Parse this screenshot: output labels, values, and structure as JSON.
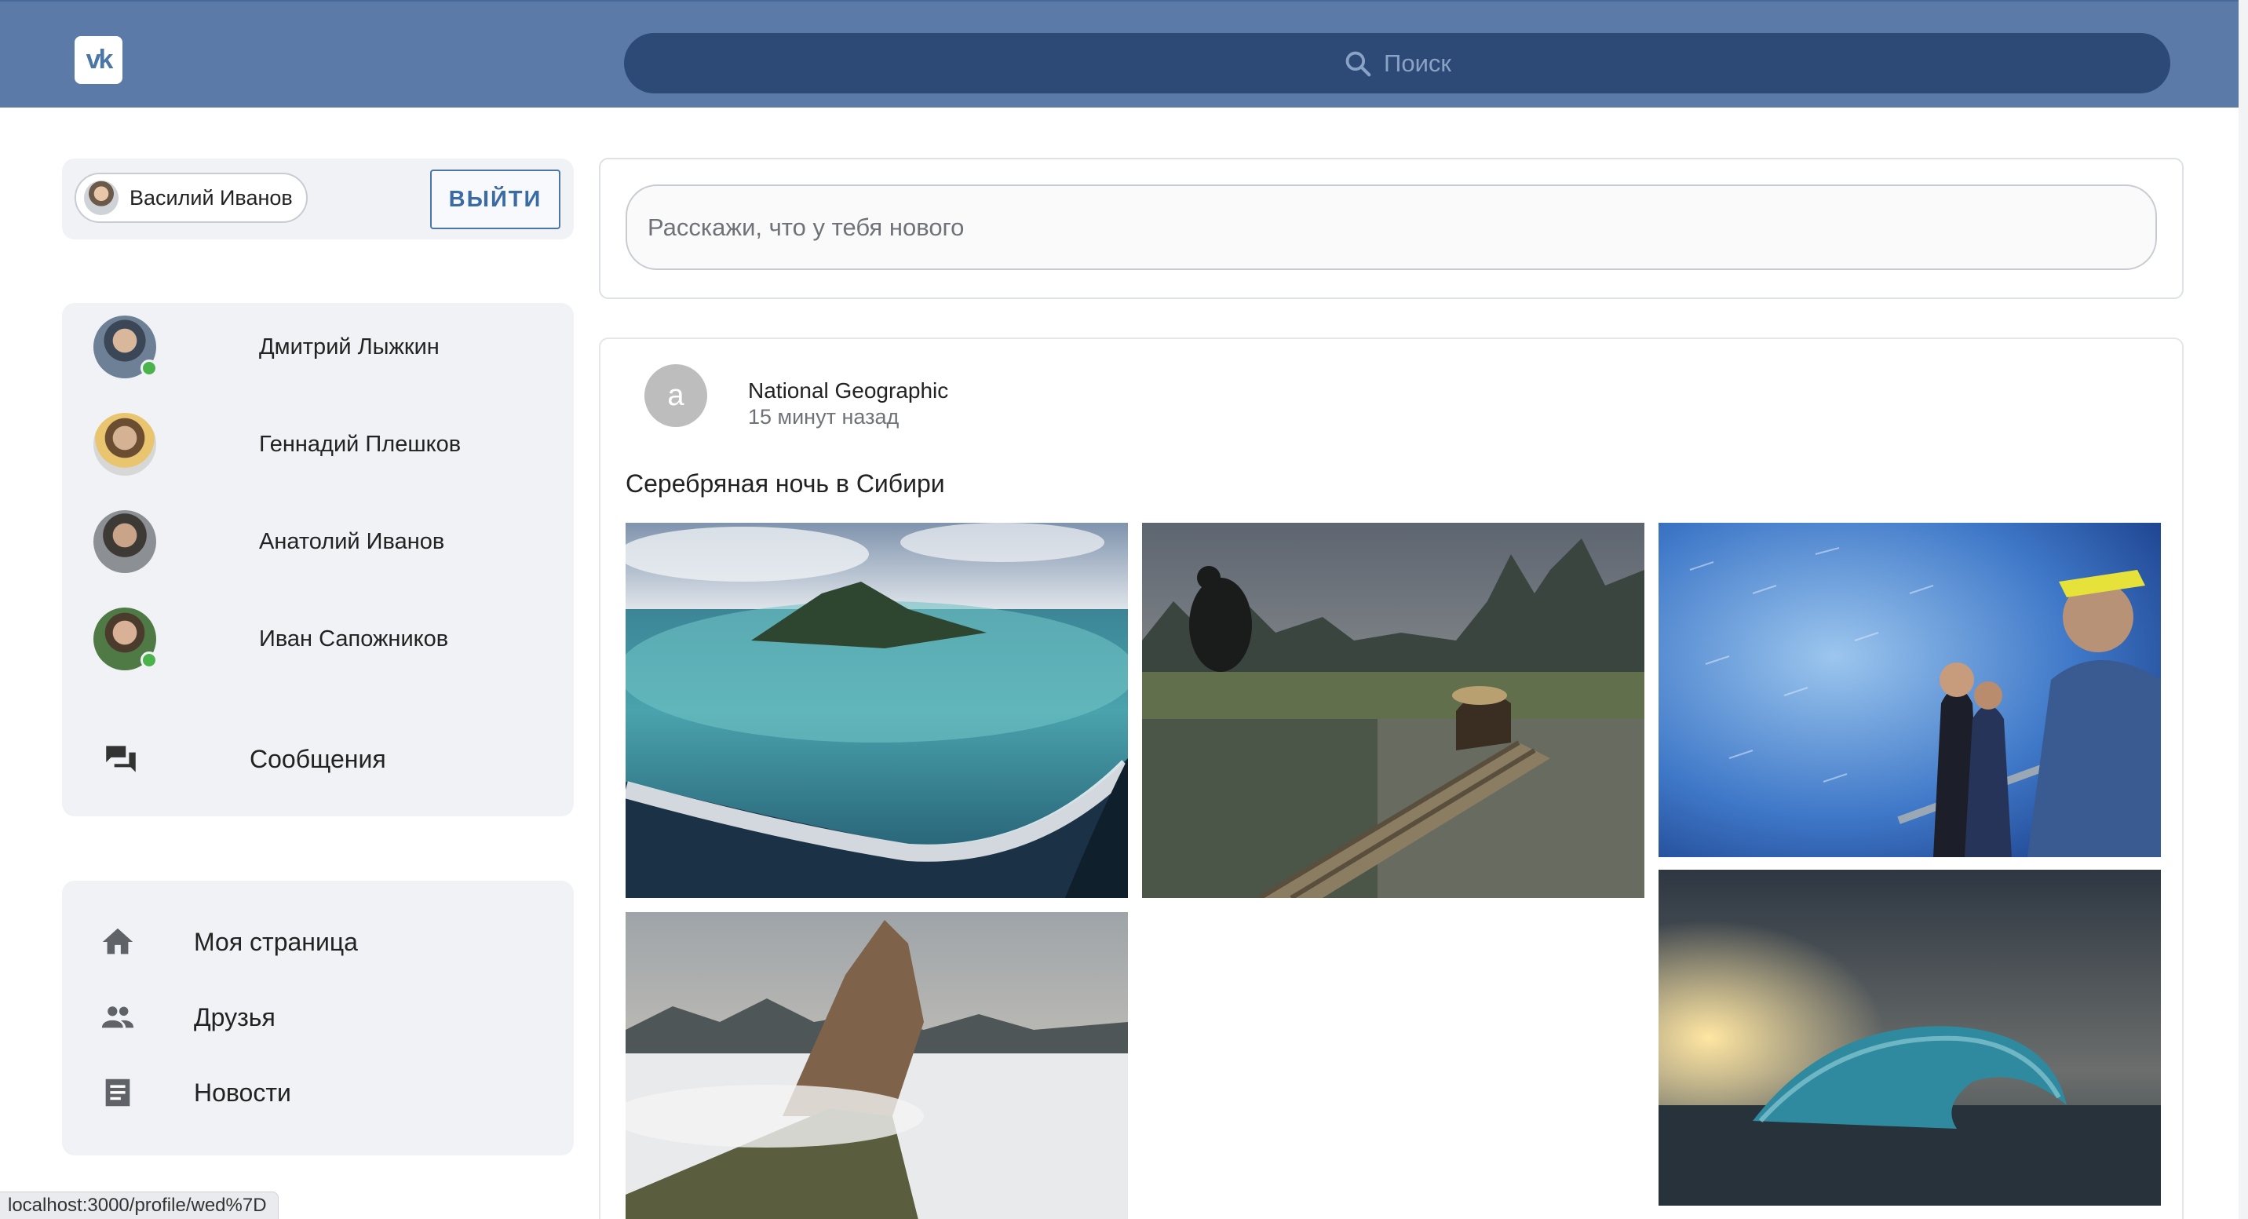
{
  "header": {
    "logo_text": "vk",
    "search_placeholder": "Поиск"
  },
  "user": {
    "name": "Василий Иванов",
    "logout_label": "ВЫЙТИ"
  },
  "friends": [
    {
      "name": "Дмитрий Лыжкин",
      "online": true
    },
    {
      "name": "Геннадий Плешков",
      "online": false
    },
    {
      "name": "Анатолий Иванов",
      "online": false
    },
    {
      "name": "Иван Сапожников",
      "online": true
    }
  ],
  "messages_label": "Сообщения",
  "nav": [
    {
      "label": "Моя страница",
      "icon": "home-icon"
    },
    {
      "label": "Друзья",
      "icon": "people-icon"
    },
    {
      "label": "Новости",
      "icon": "article-icon"
    }
  ],
  "composer": {
    "placeholder": "Расскажи, что у тебя нового"
  },
  "post": {
    "avatar_letter": "a",
    "author": "National Geographic",
    "time": "15 минут назад",
    "text": "Серебряная ночь в Сибири",
    "photos": [
      "aerial-island-lagoon",
      "cormorant-fisherman-raft",
      "sardine-aquarium-visitors",
      "sea-cliff-above-fog",
      "giant-ocean-wave"
    ]
  },
  "status_url": "localhost:3000/profile/wed%7D",
  "colors": {
    "header_bg": "#5b7aa7",
    "search_bg": "#2d4a76",
    "accent": "#4a76a8",
    "panel_bg": "#f0f2f5",
    "online": "#4bb34b"
  }
}
